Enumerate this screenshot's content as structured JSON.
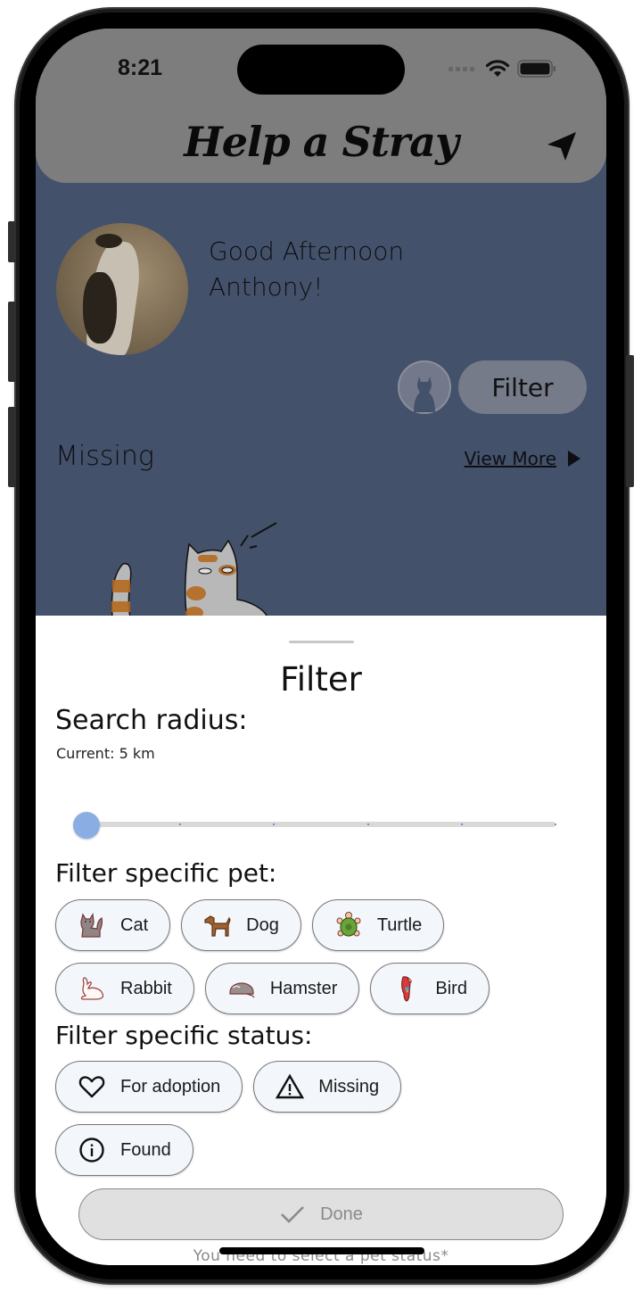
{
  "status_bar": {
    "time": "8:21",
    "icons": [
      "cellular-signal-icon",
      "wifi-icon",
      "battery-icon"
    ]
  },
  "app_bar": {
    "title": "Help a Stray",
    "action_icon": "send-icon"
  },
  "home": {
    "greeting_line1": "Good Afternoon",
    "greeting_line2": "Anthony!",
    "filter_button_label": "Filter",
    "section_title": "Missing",
    "view_more_label": "View More"
  },
  "filter_sheet": {
    "title": "Filter",
    "search_radius_label": "Search radius:",
    "current_radius_label": "Current: 5 km",
    "slider": {
      "stops": 6,
      "selected_stop_index": 0,
      "fraction": 0.0
    },
    "pet_section_label": "Filter specific pet:",
    "pets": [
      {
        "label": "Cat",
        "icon": "cat-icon"
      },
      {
        "label": "Dog",
        "icon": "dog-icon"
      },
      {
        "label": "Turtle",
        "icon": "turtle-icon"
      },
      {
        "label": "Rabbit",
        "icon": "rabbit-icon"
      },
      {
        "label": "Hamster",
        "icon": "hamster-icon"
      },
      {
        "label": "Bird",
        "icon": "parrot-icon"
      }
    ],
    "status_section_label": "Filter specific status:",
    "statuses": [
      {
        "label": "For adoption",
        "icon": "heart-icon"
      },
      {
        "label": "Missing",
        "icon": "warning-icon"
      },
      {
        "label": "Found",
        "icon": "info-icon"
      }
    ],
    "done_label": "Done",
    "hint": "You need to select a pet status*"
  },
  "colors": {
    "scrim_background": "#44516a",
    "app_bar": "#7d7d7d",
    "slider_thumb": "#8aaee4",
    "chip_background": "#f3f7fc",
    "done_disabled": "#e0e0e0"
  }
}
